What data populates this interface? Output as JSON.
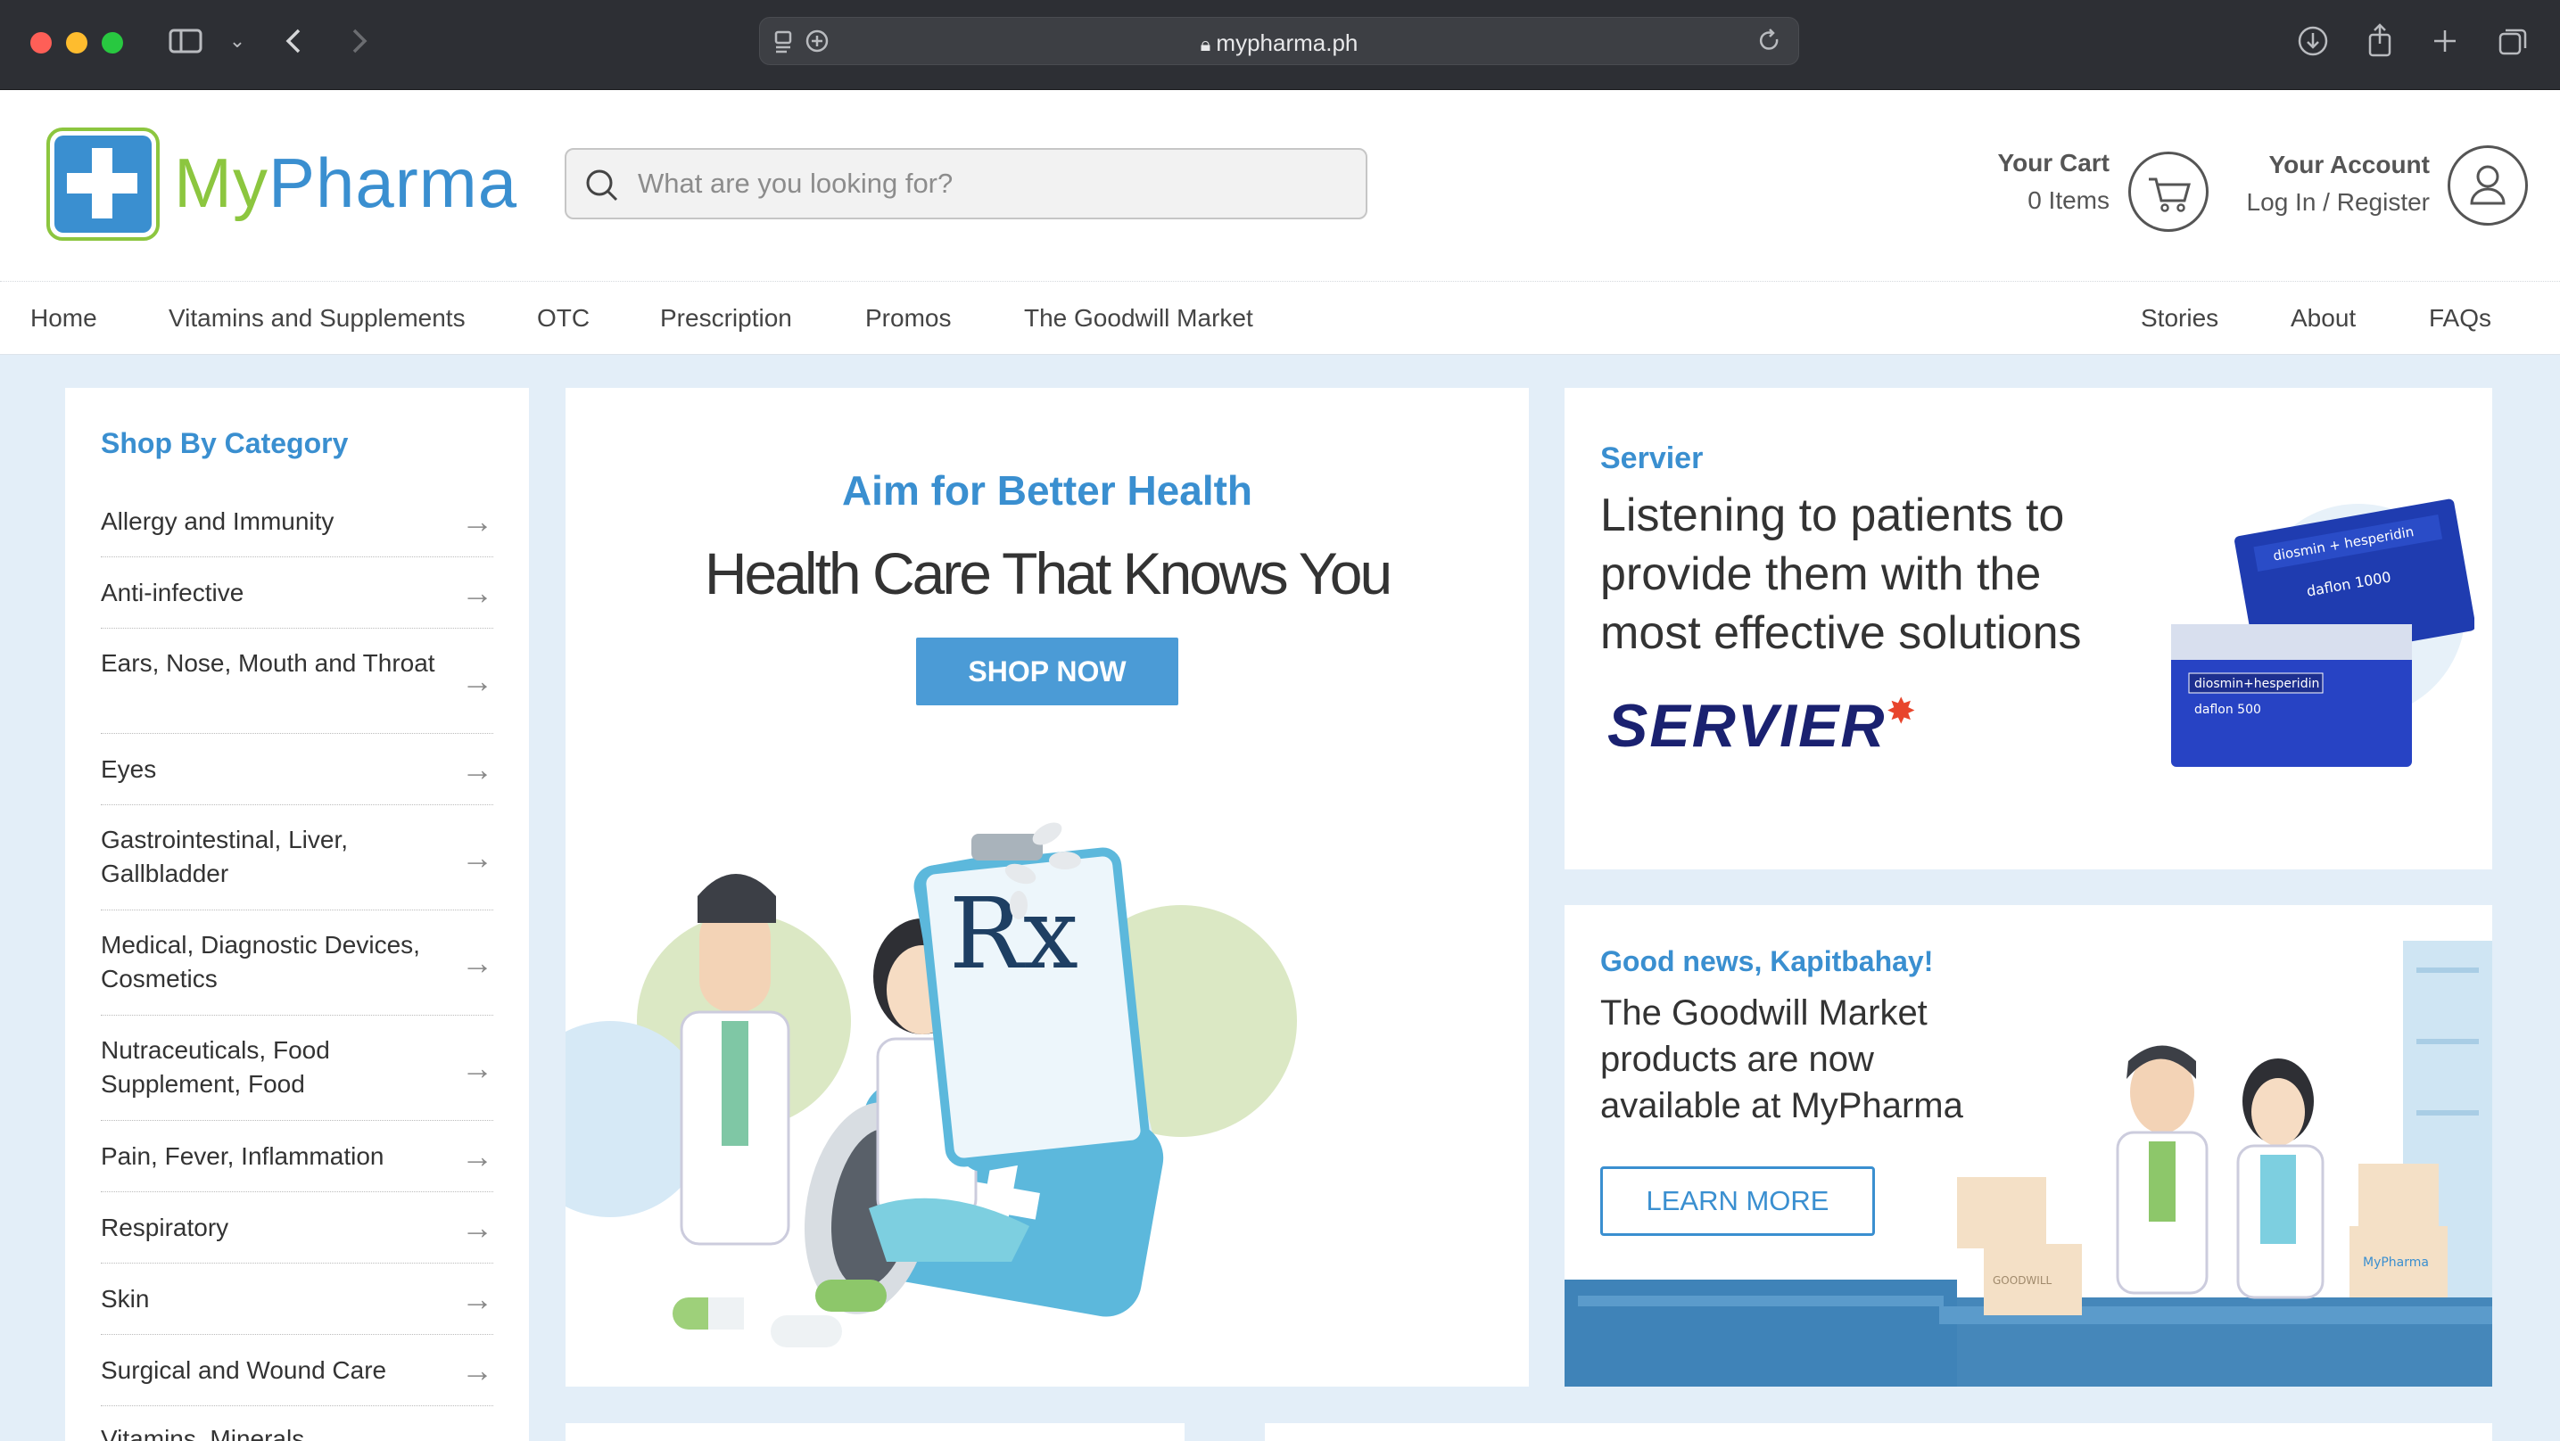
{
  "browser": {
    "url": "mypharma.ph",
    "traffic_light_colors": [
      "#fe5f57",
      "#febc2e",
      "#28c840"
    ]
  },
  "header": {
    "logo_text_my": "My",
    "logo_text_pharma": "Pharma",
    "logo_colors": {
      "my": "#8cc63f",
      "pharma": "#3a8fd0"
    },
    "search_placeholder": "What are you looking for?",
    "cart_title": "Your Cart",
    "cart_items": "0 Items",
    "account_title": "Your Account",
    "account_link": "Log In / Register"
  },
  "nav": {
    "left": [
      "Home",
      "Vitamins and Supplements",
      "OTC",
      "Prescription",
      "Promos",
      "The Goodwill Market"
    ],
    "right": [
      "Stories",
      "About",
      "FAQs"
    ]
  },
  "sidebar": {
    "title": "Shop By Category",
    "categories": [
      "Allergy and Immunity",
      "Anti-infective",
      "Ears, Nose, Mouth and Throat",
      "Eyes",
      "Gastrointestinal, Liver, Gallbladder",
      "Medical, Diagnostic Devices, Cosmetics",
      "Nutraceuticals, Food Supplement, Food",
      "Pain, Fever, Inflammation",
      "Respiratory",
      "Skin",
      "Surgical and Wound Care",
      "Vitamins, Minerals"
    ]
  },
  "hero": {
    "subtitle": "Aim for Better Health",
    "title": "Health Care That Knows You",
    "button": "SHOP NOW",
    "rx": "Rx"
  },
  "servier": {
    "brand": "Servier",
    "message": "Listening to patients to provide them with the most effective solutions",
    "logo": "SERVIER",
    "box1_text": "diosmin + hesperidin",
    "box1_name": "daflon 1000",
    "box2_text": "diosmin+hesperidin",
    "box2_name": "daflon 500"
  },
  "goodwill": {
    "headline": "Good news, Kapitbahay!",
    "message": "The Goodwill Market products are now available at MyPharma",
    "button": "LEARN MORE",
    "box_label_goodwill": "GOODWILL",
    "box_label_mypharma": "MyPharma"
  }
}
